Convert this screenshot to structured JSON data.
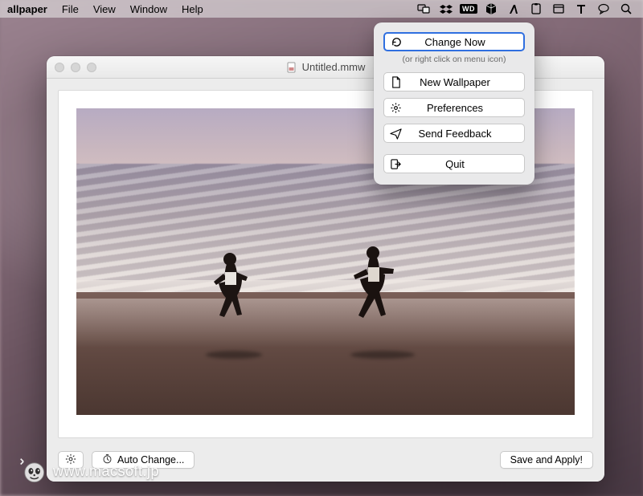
{
  "menubar": {
    "app_name": "allpaper",
    "items": [
      "File",
      "View",
      "Window",
      "Help"
    ],
    "status_icons": [
      "display-icon",
      "dropbox-icon",
      "wd-icon",
      "cube-icon",
      "lambda-icon",
      "clipboard-icon",
      "window-icon",
      "text-icon",
      "chat-icon",
      "search-icon"
    ]
  },
  "window": {
    "title": "Untitled.mmw"
  },
  "toolbar": {
    "settings_label": "",
    "auto_change_label": "Auto Change...",
    "save_apply_label": "Save and Apply!"
  },
  "popover": {
    "change_now": "Change Now",
    "hint": "(or right click on menu icon)",
    "new_wallpaper": "New Wallpaper",
    "preferences": "Preferences",
    "send_feedback": "Send Feedback",
    "quit": "Quit"
  },
  "watermark": {
    "text": "www.macsoft.jp"
  }
}
